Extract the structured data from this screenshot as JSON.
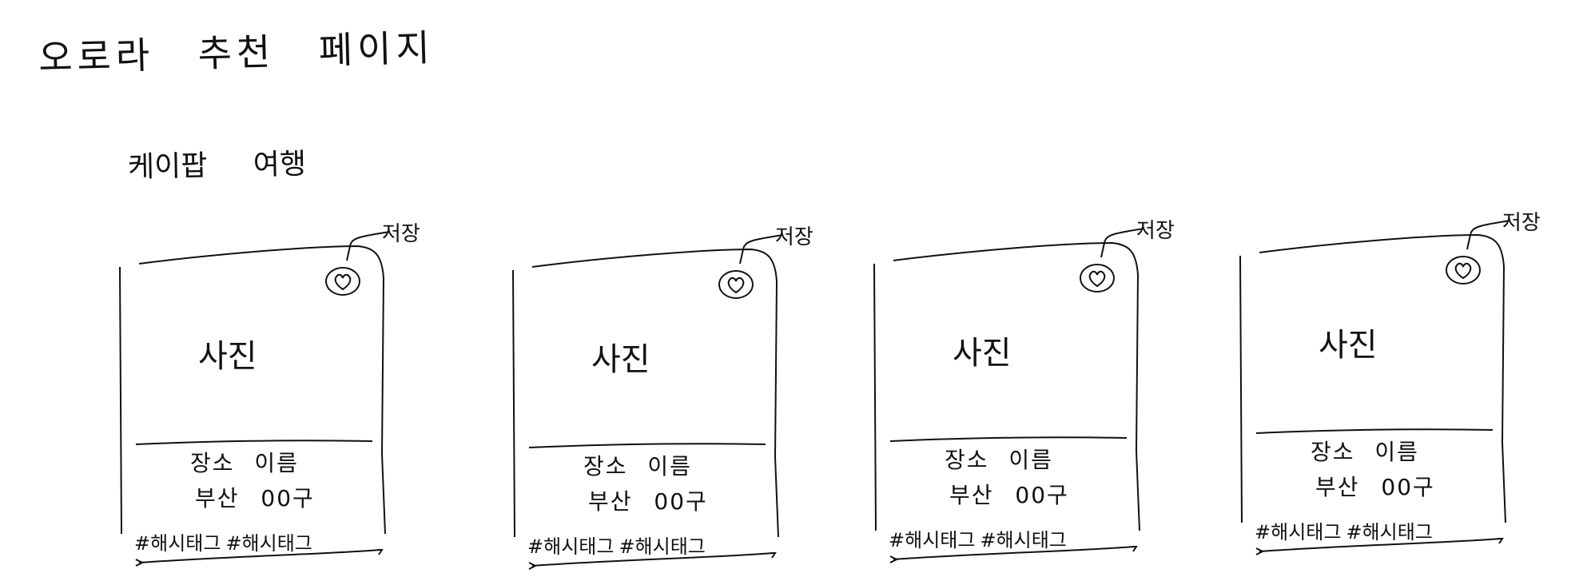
{
  "page": {
    "title": "오로라 추천 페이지"
  },
  "section": {
    "title": "케이팝 여행"
  },
  "cards": [
    {
      "save_label": "저장",
      "photo_label": "사진",
      "place_name": "장소 이름",
      "place_location": "부산 00구",
      "hashtags": [
        "#해시태그",
        "#해시태그"
      ]
    },
    {
      "save_label": "저장",
      "photo_label": "사진",
      "place_name": "장소 이름",
      "place_location": "부산 00구",
      "hashtags": [
        "#해시태그",
        "#해시태그"
      ]
    },
    {
      "save_label": "저장",
      "photo_label": "사진",
      "place_name": "장소 이름",
      "place_location": "부산 00구",
      "hashtags": [
        "#해시태그",
        "#해시태그"
      ]
    },
    {
      "save_label": "저장",
      "photo_label": "사진",
      "place_name": "장소 이름",
      "place_location": "부산 00구",
      "hashtags": [
        "#해시태그",
        "#해시태그"
      ]
    }
  ]
}
